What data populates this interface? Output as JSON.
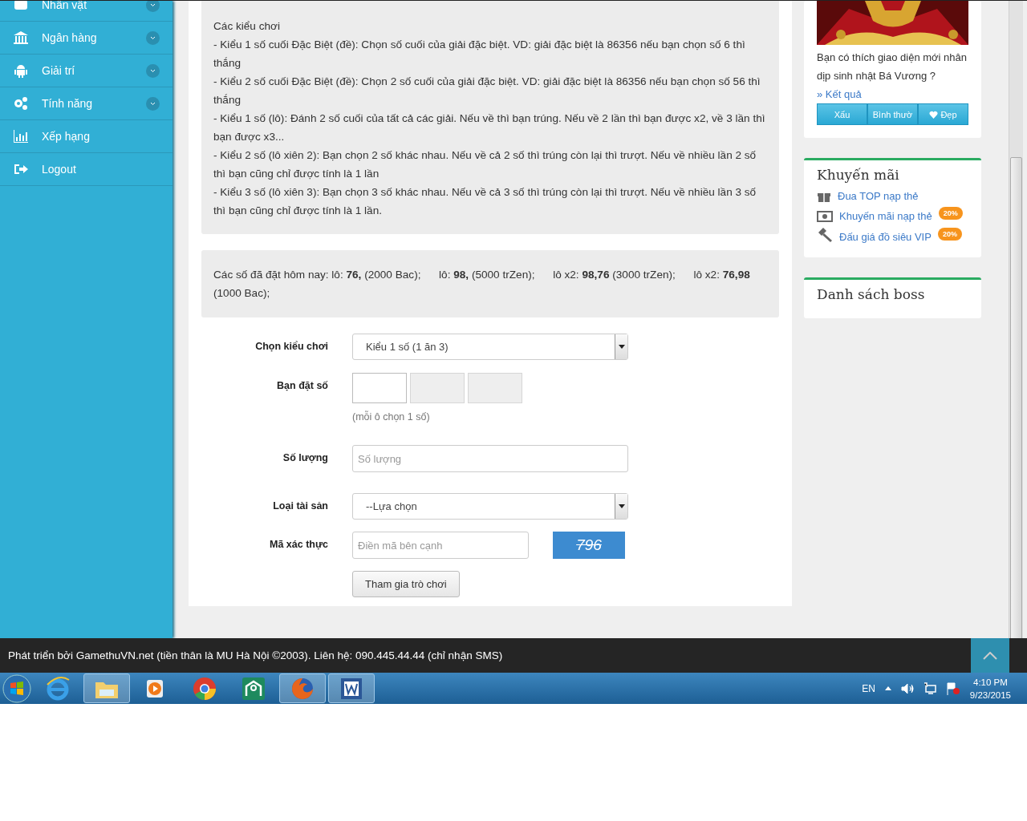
{
  "sidebar": {
    "items": [
      {
        "label": "Nhân vật",
        "expandable": true
      },
      {
        "label": "Ngân hàng",
        "expandable": true
      },
      {
        "label": "Giải trí",
        "expandable": true
      },
      {
        "label": "Tính năng",
        "expandable": true
      },
      {
        "label": "Xếp hạng",
        "expandable": false
      },
      {
        "label": "Logout",
        "expandable": false
      }
    ]
  },
  "rules": {
    "title": "Các kiểu chơi",
    "lines": [
      "- Kiểu 1 số cuối Đặc Biệt (đề): Chọn số cuối của giải đặc biệt. VD: giải đặc biệt là 86356 nếu bạn chọn số 6 thì thắng",
      "- Kiểu 2 số cuối Đặc Biệt (đề): Chọn 2 số cuối của giải đặc biệt. VD: giải đặc biệt là 86356 nếu bạn chọn số 56 thì thắng",
      "- Kiểu 1 số (lô): Đánh 2 số cuối của tất cả các giải. Nếu về thì bạn trúng. Nếu về 2 lần thì bạn được x2, về 3 lần thì bạn được x3...",
      "- Kiểu 2 số (lô xiên 2): Bạn chọn 2 số khác nhau. Nếu về cả 2 số thì trúng còn lại thì trượt. Nếu về nhiều lần 2 số thì bạn cũng chỉ được tính là 1 lần",
      "- Kiểu 3 số (lô xiên 3): Bạn chọn 3 số khác nhau. Nếu về cả 3 số thì trúng còn lại thì trượt. Nếu về nhiều lần 3 số thì bạn cũng chỉ được tính là 1 lần."
    ]
  },
  "bets": {
    "text": "Các số đã đặt hôm nay: lô: **76,** (2000 Bac);      lô: **98,** (5000 trZen);      lô x2: **98,76** (3000 trZen);      lô x2: **76,98** (1000 Bac);"
  },
  "form": {
    "play_type": {
      "label": "Chọn kiểu chơi",
      "value": "Kiểu 1 số (1 ăn 3)"
    },
    "numbers": {
      "label": "Bạn đặt số",
      "boxes": [
        {
          "disabled": false
        },
        {
          "disabled": true
        },
        {
          "disabled": true
        }
      ],
      "hint": "(mỗi ô chọn 1 số)"
    },
    "quantity": {
      "label": "Số lượng",
      "placeholder": "Số lượng"
    },
    "asset": {
      "label": "Loại tài sản",
      "value": "--Lựa chọn"
    },
    "captcha": {
      "label": "Mã xác thực",
      "placeholder": "Điền mã bên cạnh",
      "code": "796"
    },
    "submit": "Tham gia trò chơi"
  },
  "poll": {
    "question": "Bạn có thích giao diện mới nhân dịp sinh nhật Bá Vương ?",
    "result_link": "» Kết quả",
    "options": [
      {
        "label": "Xấu",
        "heart": false
      },
      {
        "label": "Bình thườ",
        "heart": false
      },
      {
        "label": "Đẹp",
        "heart": true
      }
    ]
  },
  "promotions": {
    "title": "Khuyến mãi",
    "items": [
      {
        "label": "Đua TOP nạp thẻ"
      },
      {
        "label": "Khuyến mãi nạp thẻ",
        "badge": "20%"
      },
      {
        "label": "Đấu giá đồ siêu VIP",
        "badge": "20%"
      }
    ]
  },
  "boss_list": {
    "title": "Danh sách boss"
  },
  "footer": {
    "text": "Phát triển bởi GamethuVN.net (tiền thân là MU Hà Nội ©2003). Liên hệ: 090.445.44.44 (chỉ nhận SMS)"
  },
  "taskbar": {
    "apps": [
      {
        "open": false
      },
      {
        "open": true
      },
      {
        "open": false
      },
      {
        "open": false
      },
      {
        "open": false
      },
      {
        "open": true
      },
      {
        "open": true
      }
    ],
    "language": "EN",
    "time": "4:10 PM",
    "date": "9/23/2015"
  }
}
